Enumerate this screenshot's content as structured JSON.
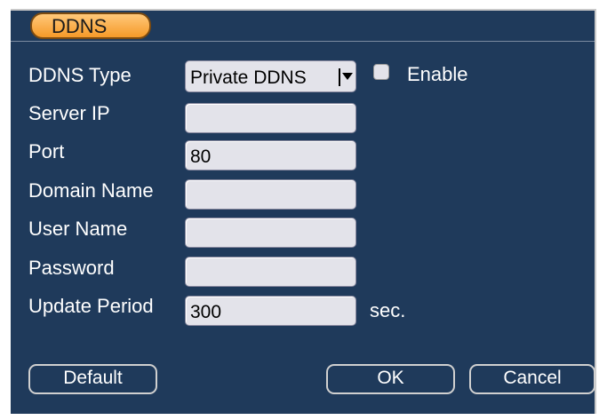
{
  "tab": {
    "label": "DDNS"
  },
  "form": {
    "ddns_type": {
      "label": "DDNS Type",
      "value": "Private DDNS"
    },
    "enable": {
      "label": "Enable",
      "checked": false
    },
    "server_ip": {
      "label": "Server IP",
      "value": ""
    },
    "port": {
      "label": "Port",
      "value": "80"
    },
    "domain_name": {
      "label": "Domain Name",
      "value": ""
    },
    "user_name": {
      "label": "User Name",
      "value": ""
    },
    "password": {
      "label": "Password",
      "value": ""
    },
    "update_period": {
      "label": "Update Period",
      "value": "300",
      "unit": "sec."
    }
  },
  "buttons": {
    "default": "Default",
    "ok": "OK",
    "cancel": "Cancel"
  },
  "colors": {
    "background": "#1f3a5b",
    "tab": "#f59a28",
    "field": "#e3e3ea"
  }
}
